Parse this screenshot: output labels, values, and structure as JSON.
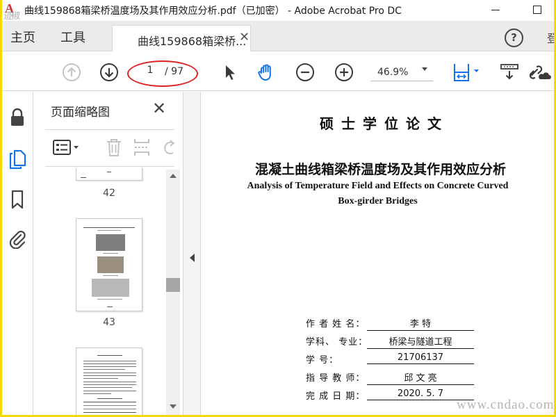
{
  "window": {
    "title": "曲线159868箱梁桥温度场及其作用效应分析.pdf（已加密） - Adobe Acrobat Pro DC",
    "logo_mark": "A",
    "logo_text": "迹椒网"
  },
  "menubar": {
    "home": "主页",
    "tools": "工具",
    "tab_label": "曲线159868箱梁桥...",
    "tab_close": "✕",
    "help": "?",
    "login_cut": "登"
  },
  "toolbar": {
    "current_page": "1",
    "total_pages": "/ 97",
    "zoom": "46.9%",
    "highlight_color": "#e02020"
  },
  "thumbnails_panel": {
    "title": "页面缩略图",
    "close": "✕",
    "pages": [
      "42",
      "43"
    ]
  },
  "document": {
    "degree_label": "硕士学位论文",
    "title_cn": "混凝土曲线箱梁桥温度场及其作用效应分析",
    "title_en_1": "Analysis of Temperature Field and Effects on Concrete Curved",
    "title_en_2": "Box-girder Bridges",
    "info": [
      {
        "label": "作 者 姓 名：",
        "value": "李   特"
      },
      {
        "label": "学科、 专业：",
        "value": "桥梁与隧道工程"
      },
      {
        "label": "学        号：",
        "value": "21706137"
      },
      {
        "label": "指 导 教 师：",
        "value": "邱 文 亮"
      },
      {
        "label": "完 成 日 期：",
        "value": "2020. 5. 7"
      }
    ]
  },
  "watermark": {
    "url": "www.cndao.com"
  },
  "colors": {
    "frame": "#f5d800",
    "accent": "#1473e6"
  }
}
